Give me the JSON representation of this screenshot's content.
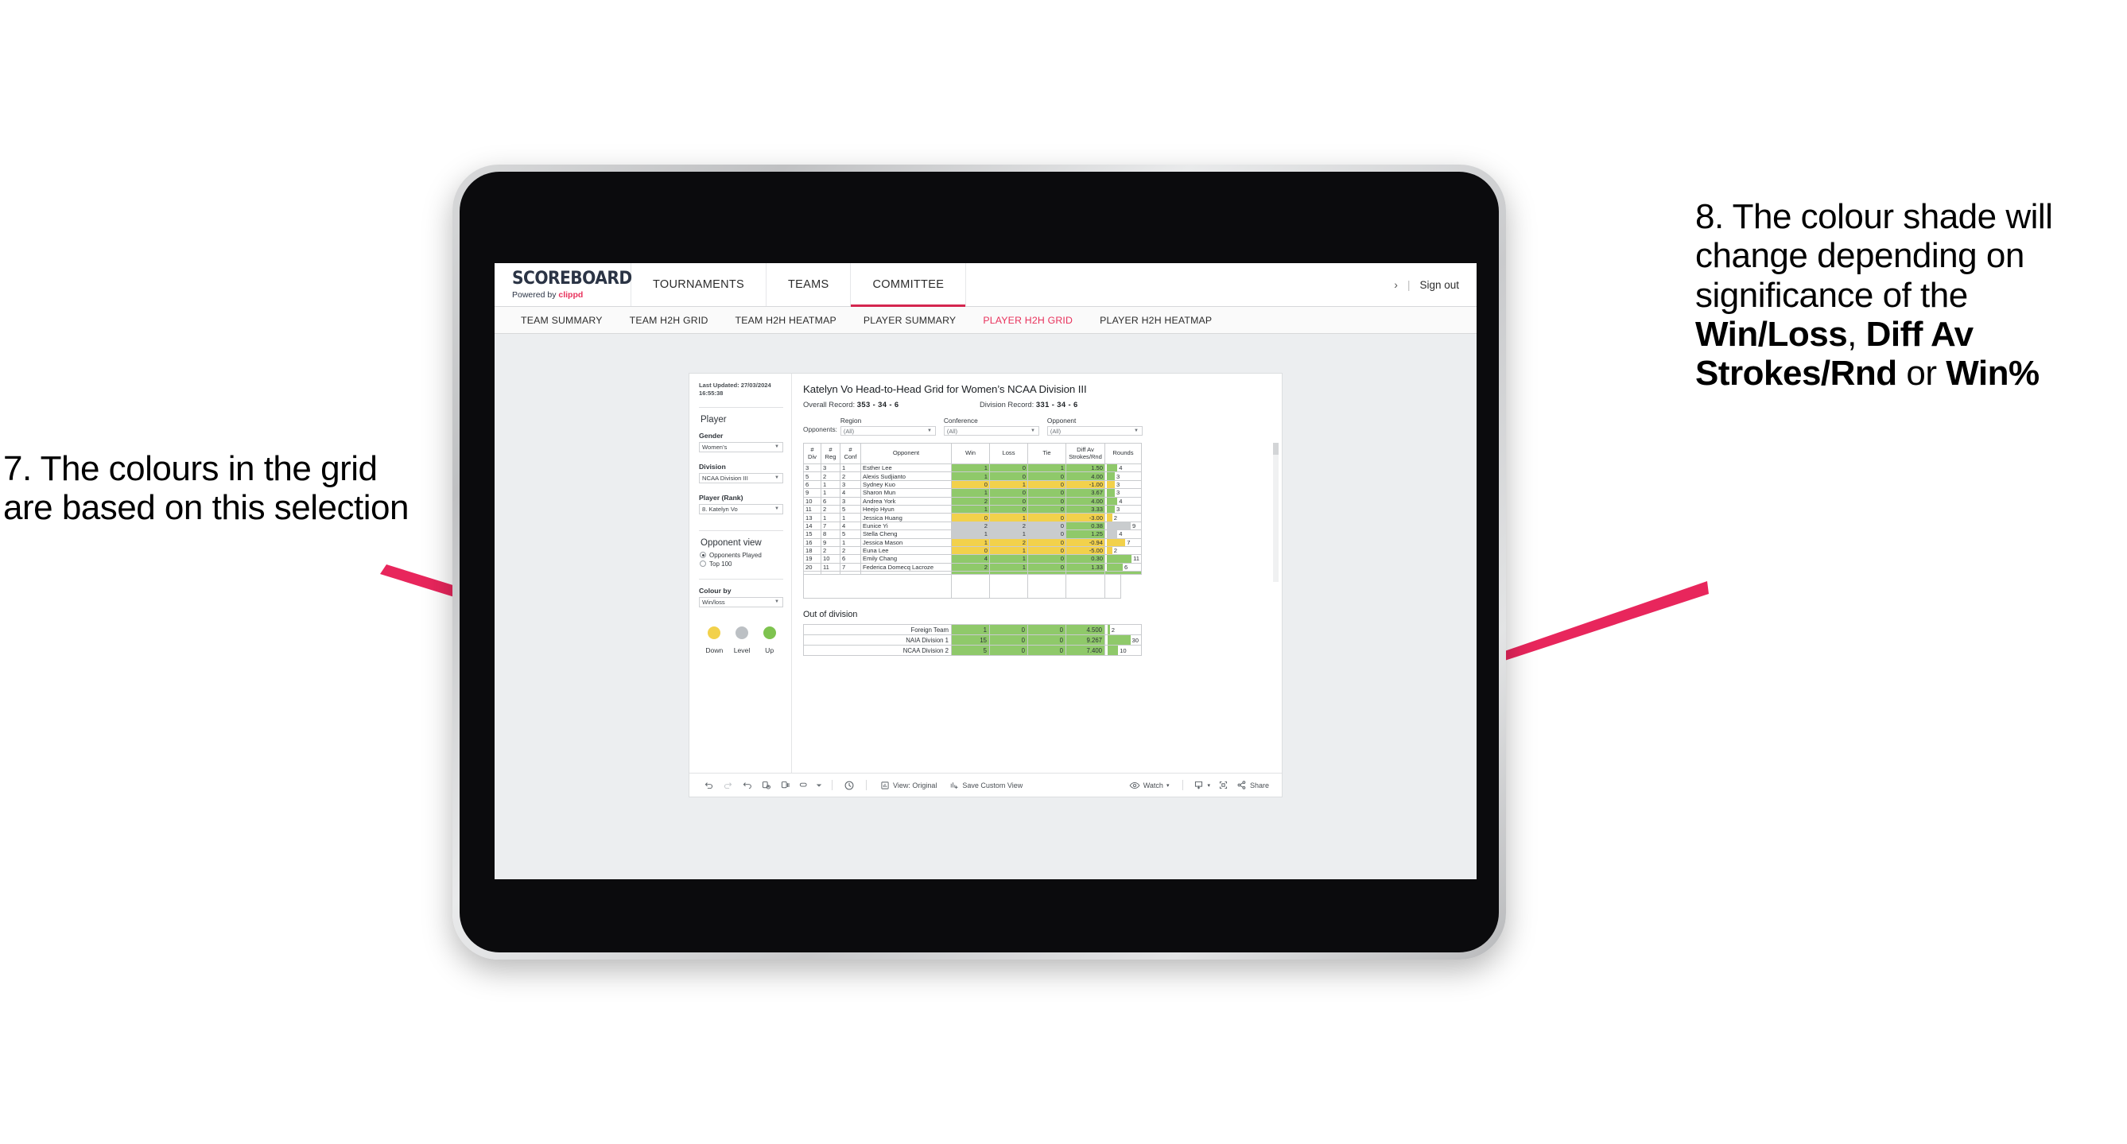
{
  "annotations": {
    "left": "7. The colours in the grid are based on this selection",
    "right_pre": "8. The colour shade will change depending on significance of the ",
    "right_b1": "Win/Loss",
    "right_mid1": ", ",
    "right_b2": "Diff Av Strokes/Rnd",
    "right_mid2": " or ",
    "right_b3": "Win%",
    "accent": "#e8265c"
  },
  "header": {
    "brand_title": "SCOREBOARD",
    "brand_sub_pre": "Powered by ",
    "brand_sub_name": "clippd",
    "tabs": [
      {
        "label": "TOURNAMENTS",
        "active": false
      },
      {
        "label": "TEAMS",
        "active": false
      },
      {
        "label": "COMMITTEE",
        "active": true
      }
    ],
    "chevron": "›",
    "separator": "|",
    "sign_out": "Sign out"
  },
  "subnav": {
    "items": [
      {
        "label": "TEAM SUMMARY",
        "active": false
      },
      {
        "label": "TEAM H2H GRID",
        "active": false
      },
      {
        "label": "TEAM H2H HEATMAP",
        "active": false
      },
      {
        "label": "PLAYER SUMMARY",
        "active": false
      },
      {
        "label": "PLAYER H2H GRID",
        "active": true
      },
      {
        "label": "PLAYER H2H HEATMAP",
        "active": false
      }
    ]
  },
  "filters": {
    "last_updated": "Last Updated: 27/03/2024 16:55:38",
    "player_heading": "Player",
    "gender": {
      "label": "Gender",
      "value": "Women’s"
    },
    "division": {
      "label": "Division",
      "value": "NCAA Division III"
    },
    "player_rank": {
      "label": "Player (Rank)",
      "value": "8. Katelyn Vo"
    },
    "opponent_view": {
      "heading": "Opponent view",
      "options": [
        {
          "label": "Opponents Played",
          "selected": true
        },
        {
          "label": "Top 100",
          "selected": false
        }
      ]
    },
    "colour_by": {
      "label": "Colour by",
      "value": "Win/loss"
    },
    "legend": [
      {
        "label": "Down",
        "color": "#f2d14b"
      },
      {
        "label": "Level",
        "color": "#bcc0c4"
      },
      {
        "label": "Up",
        "color": "#7ec34f"
      }
    ]
  },
  "main": {
    "title": "Katelyn Vo Head-to-Head Grid for Women’s NCAA Division III",
    "overall_record_label": "Overall Record: ",
    "overall_record_value": "353 -  34 - 6",
    "division_record_label": "Division Record: ",
    "division_record_value": "331 -  34 - 6",
    "opponents_label": "Opponents:",
    "opponent_filters": [
      {
        "title": "Region",
        "value": "(All)"
      },
      {
        "title": "Conference",
        "value": "(All)"
      },
      {
        "title": "Opponent",
        "value": "(All)"
      }
    ],
    "out_of_division_title": "Out of division"
  },
  "chart_data": {
    "type": "table",
    "title": "Katelyn Vo Head-to-Head Grid for Women’s NCAA Division III",
    "columns": [
      "# Div",
      "# Reg",
      "# Conf",
      "Opponent",
      "Win",
      "Loss",
      "Tie",
      "Diff Av Strokes/Rnd",
      "Rounds"
    ],
    "column_lines": [
      [
        "#",
        "Div"
      ],
      [
        "#",
        "Reg"
      ],
      [
        "#",
        "Conf"
      ],
      [
        "",
        "Opponent"
      ],
      [
        "",
        "Win"
      ],
      [
        "",
        "Loss"
      ],
      [
        "",
        "Tie"
      ],
      [
        "Diff Av",
        "Strokes/Rnd"
      ],
      [
        "",
        "Rounds"
      ]
    ],
    "rows": [
      {
        "div": "3",
        "reg": "3",
        "conf": "1",
        "opponent": "Esther Lee",
        "win": "1",
        "loss": "0",
        "tie": "1",
        "diff": "1.50",
        "rounds": "4",
        "rounds_pct": 33,
        "color": "#8fc96a"
      },
      {
        "div": "5",
        "reg": "2",
        "conf": "2",
        "opponent": "Alexis Sudjianto",
        "win": "1",
        "loss": "0",
        "tie": "0",
        "diff": "4.00",
        "rounds": "3",
        "rounds_pct": 25,
        "color": "#8fc96a"
      },
      {
        "div": "6",
        "reg": "1",
        "conf": "3",
        "opponent": "Sydney Kuo",
        "win": "0",
        "loss": "1",
        "tie": "0",
        "diff": "-1.00",
        "rounds": "3",
        "rounds_pct": 25,
        "color": "#f2d14b"
      },
      {
        "div": "9",
        "reg": "1",
        "conf": "4",
        "opponent": "Sharon Mun",
        "win": "1",
        "loss": "0",
        "tie": "0",
        "diff": "3.67",
        "rounds": "3",
        "rounds_pct": 25,
        "color": "#8fc96a"
      },
      {
        "div": "10",
        "reg": "6",
        "conf": "3",
        "opponent": "Andrea York",
        "win": "2",
        "loss": "0",
        "tie": "0",
        "diff": "4.00",
        "rounds": "4",
        "rounds_pct": 33,
        "color": "#8fc96a"
      },
      {
        "div": "11",
        "reg": "2",
        "conf": "5",
        "opponent": "Heejo Hyun",
        "win": "1",
        "loss": "0",
        "tie": "0",
        "diff": "3.33",
        "rounds": "3",
        "rounds_pct": 25,
        "color": "#8fc96a"
      },
      {
        "div": "13",
        "reg": "1",
        "conf": "1",
        "opponent": "Jessica Huang",
        "win": "0",
        "loss": "1",
        "tie": "0",
        "diff": "-3.00",
        "rounds": "2",
        "rounds_pct": 17,
        "color": "#f2d14b"
      },
      {
        "div": "14",
        "reg": "7",
        "conf": "4",
        "opponent": "Eunice Yi",
        "win": "2",
        "loss": "2",
        "tie": "0",
        "diff": "0.38",
        "rounds": "9",
        "rounds_pct": 75,
        "color": "#c9ccce",
        "diff_color": "#8fc96a"
      },
      {
        "div": "15",
        "reg": "8",
        "conf": "5",
        "opponent": "Stella Cheng",
        "win": "1",
        "loss": "1",
        "tie": "0",
        "diff": "1.25",
        "rounds": "4",
        "rounds_pct": 33,
        "color": "#c9ccce",
        "diff_color": "#8fc96a"
      },
      {
        "div": "16",
        "reg": "9",
        "conf": "1",
        "opponent": "Jessica Mason",
        "win": "1",
        "loss": "2",
        "tie": "0",
        "diff": "-0.94",
        "rounds": "7",
        "rounds_pct": 58,
        "color": "#f2d14b"
      },
      {
        "div": "18",
        "reg": "2",
        "conf": "2",
        "opponent": "Euna Lee",
        "win": "0",
        "loss": "1",
        "tie": "0",
        "diff": "-5.00",
        "rounds": "2",
        "rounds_pct": 17,
        "color": "#f2d14b"
      },
      {
        "div": "19",
        "reg": "10",
        "conf": "6",
        "opponent": "Emily Chang",
        "win": "4",
        "loss": "1",
        "tie": "0",
        "diff": "0.30",
        "rounds": "11",
        "rounds_pct": 92,
        "color": "#8fc96a"
      },
      {
        "div": "20",
        "reg": "11",
        "conf": "7",
        "opponent": "Federica Domecq Lacroze",
        "win": "2",
        "loss": "1",
        "tie": "0",
        "diff": "1.33",
        "rounds": "6",
        "rounds_pct": 50,
        "color": "#8fc96a"
      }
    ],
    "out_of_division": [
      {
        "name": "Foreign Team",
        "win": "1",
        "loss": "0",
        "tie": "0",
        "diff": "4.500",
        "rounds": "2",
        "rounds_pct": 7,
        "color": "#8fc96a"
      },
      {
        "name": "NAIA Division 1",
        "win": "15",
        "loss": "0",
        "tie": "0",
        "diff": "9.267",
        "rounds": "30",
        "rounds_pct": 100,
        "color": "#8fc96a"
      },
      {
        "name": "NCAA Division 2",
        "win": "5",
        "loss": "0",
        "tie": "0",
        "diff": "7.400",
        "rounds": "10",
        "rounds_pct": 33,
        "color": "#8fc96a"
      }
    ]
  },
  "toolbar": {
    "icons": [
      "undo-icon",
      "redo-icon",
      "revert-icon",
      "refresh-icon",
      "pause-icon",
      "filter-icon",
      "caret-icon",
      "history-icon"
    ],
    "view_label": "View: Original",
    "save_label": "Save Custom View",
    "watch_label": "Watch",
    "watch_caret": "▾",
    "download_caret": "▾",
    "share_label": "Share"
  }
}
